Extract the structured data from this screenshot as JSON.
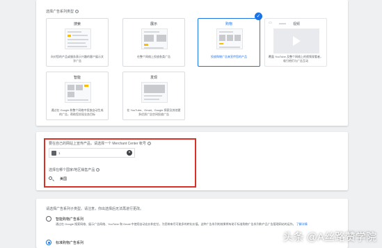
{
  "campaign_types": {
    "label": "选择广告系列类型",
    "tiles": [
      {
        "title": "搜索",
        "desc": "向对您的产品或服务表示兴趣的客户展示文字广告"
      },
      {
        "title": "展示",
        "desc": "在整个网络上投放各类广告"
      },
      {
        "title": "购物",
        "desc": "投放购物广告来宣传您的产品",
        "selected": true
      },
      {
        "title": "视频",
        "desc": "覆盖 YouTube 及整个网络上的视频观看者，吸引他们与广告互动"
      },
      {
        "title": "智能",
        "desc": "通过在 Google 和整个网络中投放自动生成的广告，帮助您实现业务目标"
      },
      {
        "title": "发现",
        "desc": "在 YouTube、Gmail、Google 探索及其他更多优质广告空间投放广告"
      }
    ]
  },
  "merchant": {
    "label": "要在自己的网站上宣传产品，请选择一个 Merchant Center 帐号",
    "account_value": "1",
    "country_label": "选择在哪个国家/地区销售产品",
    "country_value": "美国"
  },
  "subtype": {
    "label": "请选择广告系列子类型。请注意，你出选择后无法再进行更改。",
    "options": [
      {
        "title": "智能购物广告系列",
        "desc": "通过在 Google 搜索网络、展示广告网络、YouTube 和 Gmail 中使用自动出价和定位，为您带来尽可能多的转化价值。这种广告系列的效果将有助于标准购物广告系列和产品广告管理网站的运作。",
        "link": "了解详情",
        "checked": false
      },
      {
        "title": "标准购物广告系列",
        "checked": true
      }
    ]
  },
  "watermark": "头条 @A丝路赞学院",
  "colors": {
    "accent": "#1a73e8",
    "highlight": "#d93025",
    "mock_accent": "#fbbc04"
  }
}
